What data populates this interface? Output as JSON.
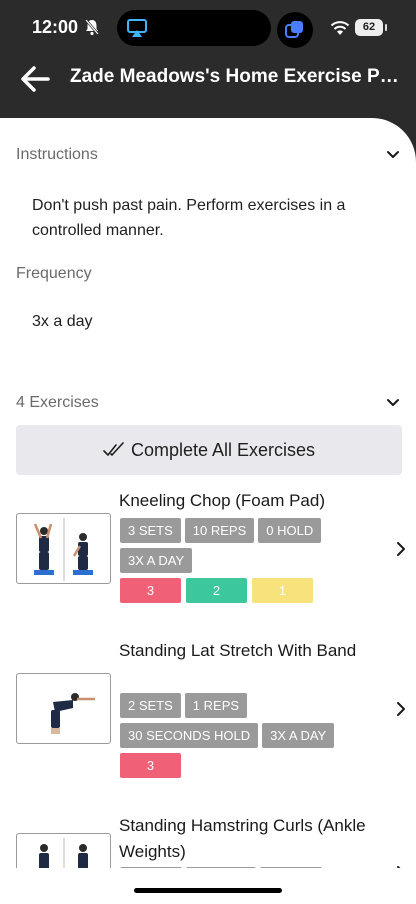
{
  "status": {
    "time": "12:00",
    "battery": "62"
  },
  "header": {
    "title": "Zade Meadows's Home Exercise Program"
  },
  "instructions": {
    "label": "Instructions",
    "text": "Don't push past pain. Perform exercises in a controlled manner."
  },
  "frequency": {
    "label": "Frequency",
    "value": "3x a day"
  },
  "exercises_section": {
    "label": "4 Exercises",
    "complete_all_label": "Complete All Exercises"
  },
  "exercises": [
    {
      "name": "Kneeling Chop (Foam Pad)",
      "tags": [
        "3 SETS",
        "10 REPS",
        "0 HOLD",
        "3X A DAY"
      ],
      "scores": [
        {
          "value": "3",
          "color": "#f06077"
        },
        {
          "value": "2",
          "color": "#3cc79d"
        },
        {
          "value": "1",
          "color": "#f7e27c"
        }
      ]
    },
    {
      "name": "Standing Lat Stretch With Band",
      "tags": [
        "2 SETS",
        "1 REPS",
        "30 SECONDS HOLD",
        "3X A DAY"
      ],
      "scores": [
        {
          "value": "3",
          "color": "#f06077"
        }
      ]
    },
    {
      "name": "Standing Hamstring Curls (Ankle Weights)",
      "tags": [],
      "scores": []
    }
  ],
  "colors": {
    "header_bg": "#2b2b2b",
    "tag_bg": "#9a9a9a",
    "button_bg": "#e9e8ed"
  }
}
